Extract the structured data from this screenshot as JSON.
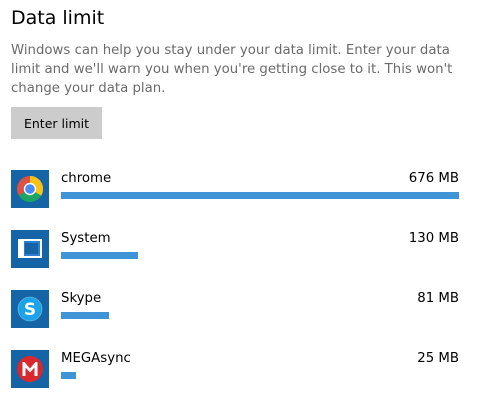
{
  "section": {
    "title": "Data limit",
    "description": "Windows can help you stay under your data limit. Enter your data limit and we'll warn you when you're getting close to it. This won't change your data plan.",
    "button_label": "Enter limit"
  },
  "colors": {
    "icon_tile": "#1565a6",
    "usage_bar": "#3f93d7",
    "button_bg": "#cccccc"
  },
  "apps": [
    {
      "name": "chrome",
      "usage": "676 MB",
      "usage_mb": 676,
      "icon": "chrome-icon"
    },
    {
      "name": "System",
      "usage": "130 MB",
      "usage_mb": 130,
      "icon": "system-icon"
    },
    {
      "name": "Skype",
      "usage": "81 MB",
      "usage_mb": 81,
      "icon": "skype-icon"
    },
    {
      "name": "MEGAsync",
      "usage": "25 MB",
      "usage_mb": 25,
      "icon": "megasync-icon"
    }
  ]
}
